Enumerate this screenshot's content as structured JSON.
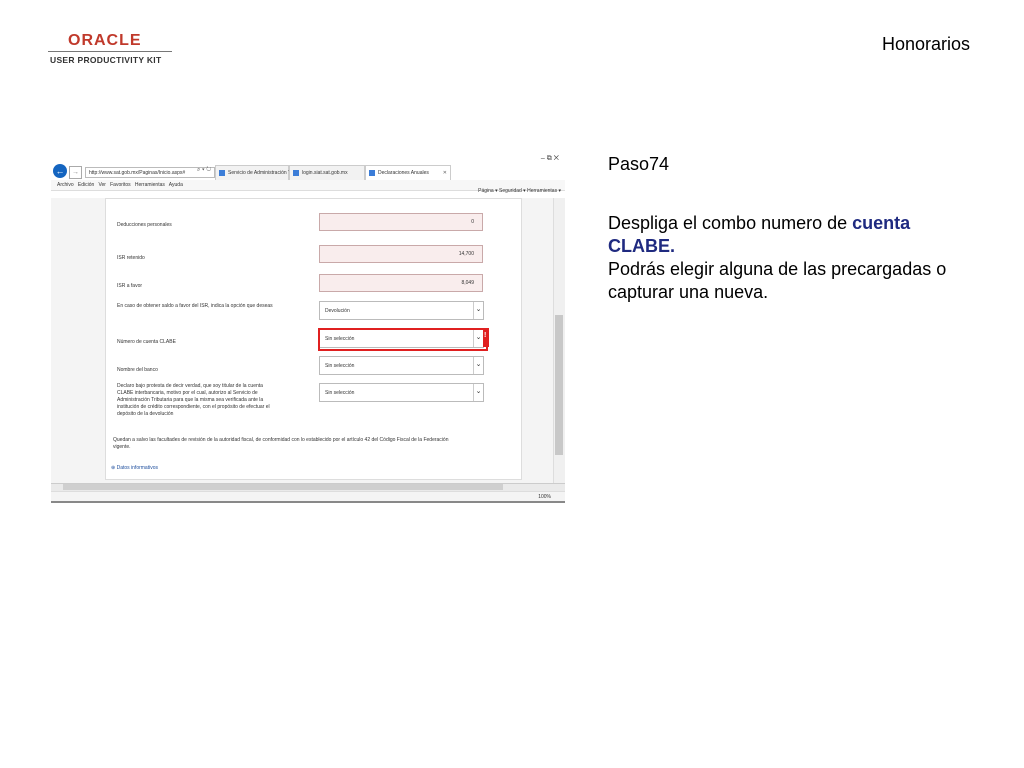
{
  "logo": {
    "brand": "ORACLE",
    "product": "USER PRODUCTIVITY KIT"
  },
  "header": {
    "title": "Honorarios"
  },
  "step": {
    "label": "Paso74"
  },
  "instruction": {
    "line1_prefix": "Despliga el combo numero de ",
    "highlight": "cuenta CLABE.",
    "line2": "Podrás elegir alguna de las precargadas o capturar una nueva."
  },
  "browser": {
    "window_controls": "–  ⧉  ✕",
    "url": "http://www.sat.gob.mx/Paginas/Inicio.aspx#",
    "url_tools": "⌕ ▾ ↻",
    "tabs": [
      {
        "label": "Servicio de Administración Tri..."
      },
      {
        "label": "login.siat.sat.gob.mx"
      },
      {
        "label": "Declaraciones Anuales"
      }
    ],
    "menu": [
      "Archivo",
      "Edición",
      "Ver",
      "Favoritos",
      "Herramientas",
      "Ayuda"
    ],
    "command_bar": "Página ▾   Seguridad ▾   Herramientas ▾",
    "zoom": "100%"
  },
  "form": {
    "deducciones_label": "Deducciones personales",
    "deducciones_value": "0",
    "isr_retenido_label": "ISR retenido",
    "isr_retenido_value": "14,700",
    "isr_favor_label": "ISR a favor",
    "isr_favor_value": "8,049",
    "opcion_label": "En caso de obtener saldo a favor del ISR, indica la opción que deseas",
    "opcion_value": "Devolución",
    "clabe_label": "Número de cuenta CLABE",
    "clabe_value": "Sin selección",
    "banco_label": "Nombre del banco",
    "banco_value": "Sin selección",
    "declaro_label": "Declaro bajo protesta de decir verdad, que soy titular de la cuenta CLABE interbancaria, motivo por el cual, autorizo al Servicio de Administración Tributaria para que la misma sea verificada ante la institución de crédito correspondiente, con el propósito de efectuar el depósito de la devolución",
    "declaro_value": "Sin selección",
    "quedan_text": "Quedan a salvo las facultades de revisión de la autoridad fiscal, de conformidad con lo establecido por el artículo 42 del Código Fiscal de la Federación vigente.",
    "datos_link": "Datos informativos"
  }
}
